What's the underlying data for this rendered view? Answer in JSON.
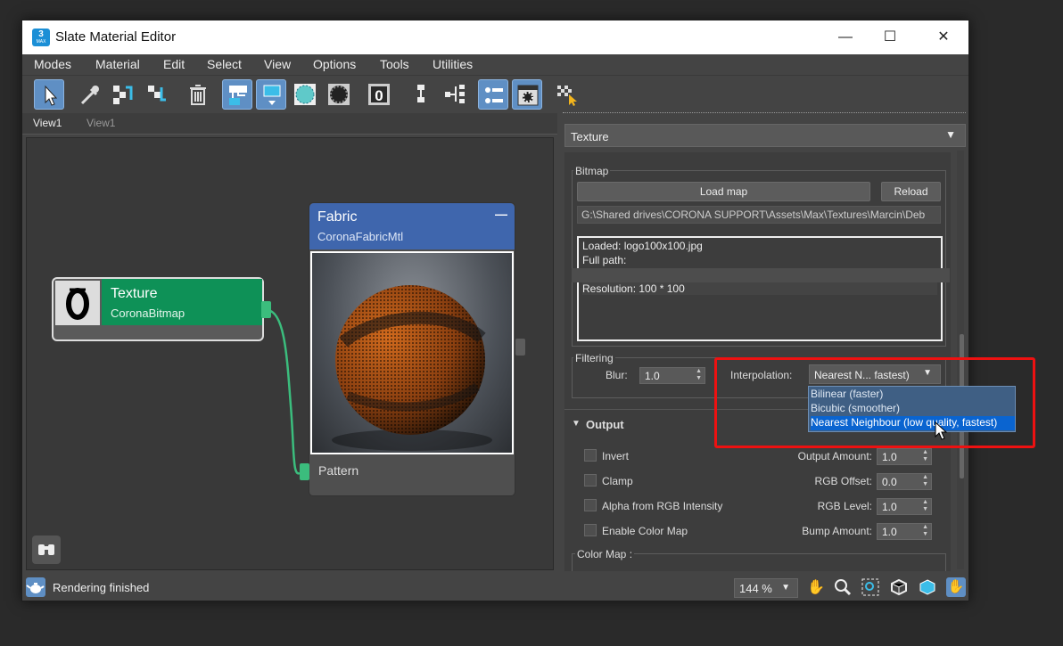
{
  "window": {
    "title": "Slate Material Editor",
    "app_icon": {
      "top": "3",
      "bottom": "MAX"
    },
    "minimize": "—",
    "maximize": "☐",
    "close": "✕"
  },
  "menu": [
    "Modes",
    "Material",
    "Edit",
    "Select",
    "View",
    "Options",
    "Tools",
    "Utilities"
  ],
  "toolbar": {
    "icons": [
      "select-tool-icon",
      "eyedropper-icon",
      "pick-material-icon",
      "put-to-scene-icon",
      "delete-icon",
      "layout-all-icon",
      "layout-children-icon",
      "checker-sphere-icon",
      "checker-dark-icon",
      "show-end-result-icon",
      "move-children-icon",
      "hide-children-icon",
      "navigator-icon",
      "param-editor-icon",
      "preview-icon"
    ],
    "badge_zero": "0"
  },
  "view_tabs": [
    "View1",
    "View1"
  ],
  "nodes": {
    "texture": {
      "title": "Texture",
      "subtitle": "CoronaBitmap",
      "header_color": "#0e9157"
    },
    "fabric": {
      "title": "Fabric",
      "subtitle": "CoronaFabricMtl",
      "collapse": "—",
      "header_color": "#3f66ad",
      "slot": "Pattern"
    }
  },
  "panel": {
    "type_dropdown": "Texture",
    "bitmap": {
      "group": "Bitmap",
      "load_map": "Load map",
      "reload": "Reload",
      "path": "G:\\Shared drives\\CORONA SUPPORT\\Assets\\Max\\Textures\\Marcin\\Deb",
      "info_lines": [
        "Loaded: logo100x100.jpg",
        "Full path:",
        "",
        "Resolution: 100 * 100"
      ]
    },
    "filtering": {
      "group": "Filtering",
      "blur_label": "Blur:",
      "blur_value": "1.0",
      "interp_label": "Interpolation:",
      "interp_value": "Nearest N... fastest)",
      "options": [
        "Bilinear (faster)",
        "Bicubic (smoother)",
        "Nearest Neighbour (low quality, fastest)"
      ],
      "selected_index": 2
    },
    "output": {
      "title": "Output",
      "checks": [
        "Invert",
        "Clamp",
        "Alpha from RGB Intensity",
        "Enable Color Map"
      ],
      "params": [
        {
          "label": "Output Amount:",
          "value": "1.0"
        },
        {
          "label": "RGB Offset:",
          "value": "0.0"
        },
        {
          "label": "RGB Level:",
          "value": "1.0"
        },
        {
          "label": "Bump Amount:",
          "value": "1.0"
        }
      ],
      "color_map": "Color Map :"
    }
  },
  "status": {
    "text": "Rendering finished",
    "zoom": "144 %"
  },
  "colors": {
    "accent": "#5f8fc4",
    "highlight": "#ee1111",
    "wire": "#3bbd7d"
  }
}
